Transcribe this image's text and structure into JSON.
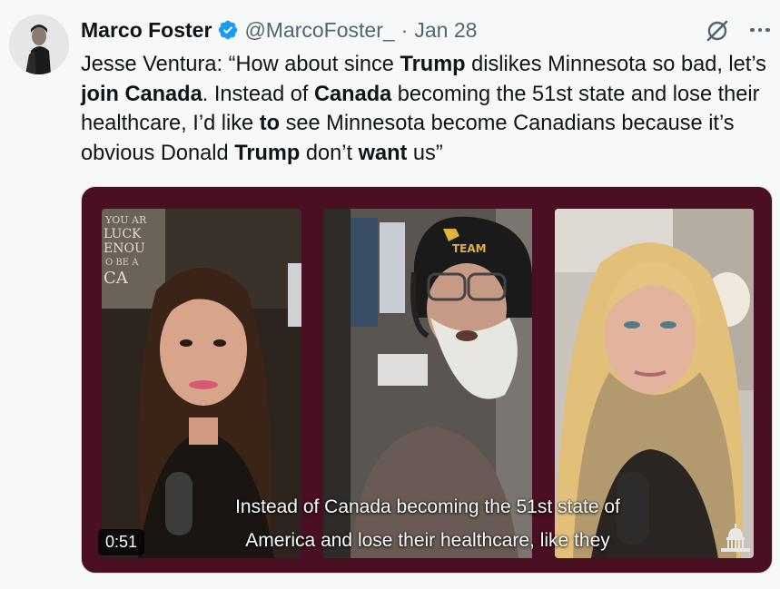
{
  "tweet": {
    "display_name": "Marco Foster",
    "handle": "@MarcoFoster_",
    "separator": "·",
    "date": "Jan 28",
    "text_segments": [
      {
        "t": "Jesse Ventura: “How about since ",
        "b": false
      },
      {
        "t": "Trump",
        "b": true
      },
      {
        "t": " dislikes Minnesota so bad, let’s ",
        "b": false
      },
      {
        "t": "join Canada",
        "b": true
      },
      {
        "t": ". Instead of ",
        "b": false
      },
      {
        "t": "Canada",
        "b": true
      },
      {
        "t": " becoming the 51st state and lose their healthcare, I’d like ",
        "b": false
      },
      {
        "t": "to",
        "b": true
      },
      {
        "t": " see Minnesota become Canadians because it’s obvious Donald ",
        "b": false
      },
      {
        "t": "Trump",
        "b": true
      },
      {
        "t": " don’t ",
        "b": false
      },
      {
        "t": "want",
        "b": true
      },
      {
        "t": " us”",
        "b": false
      }
    ]
  },
  "media": {
    "caption_line1": "Instead of Canada becoming the 51st state of",
    "caption_line2": "America and lose their healthcare, like they",
    "duration": "0:51",
    "sign_text": "YOU ARE LUCKY ENOUGH TO BE AT THE CABIN",
    "hat_text": "TEAM"
  },
  "icons": {
    "verified": "verified-badge-icon",
    "grok": "grok-icon",
    "more": "more-options-icon",
    "capitol": "capitol-dome-icon"
  },
  "colors": {
    "verified_blue": "#1d9bf0",
    "media_frame": "#4a0f22",
    "secondary_text": "#536471",
    "background": "#f7f9f9"
  }
}
